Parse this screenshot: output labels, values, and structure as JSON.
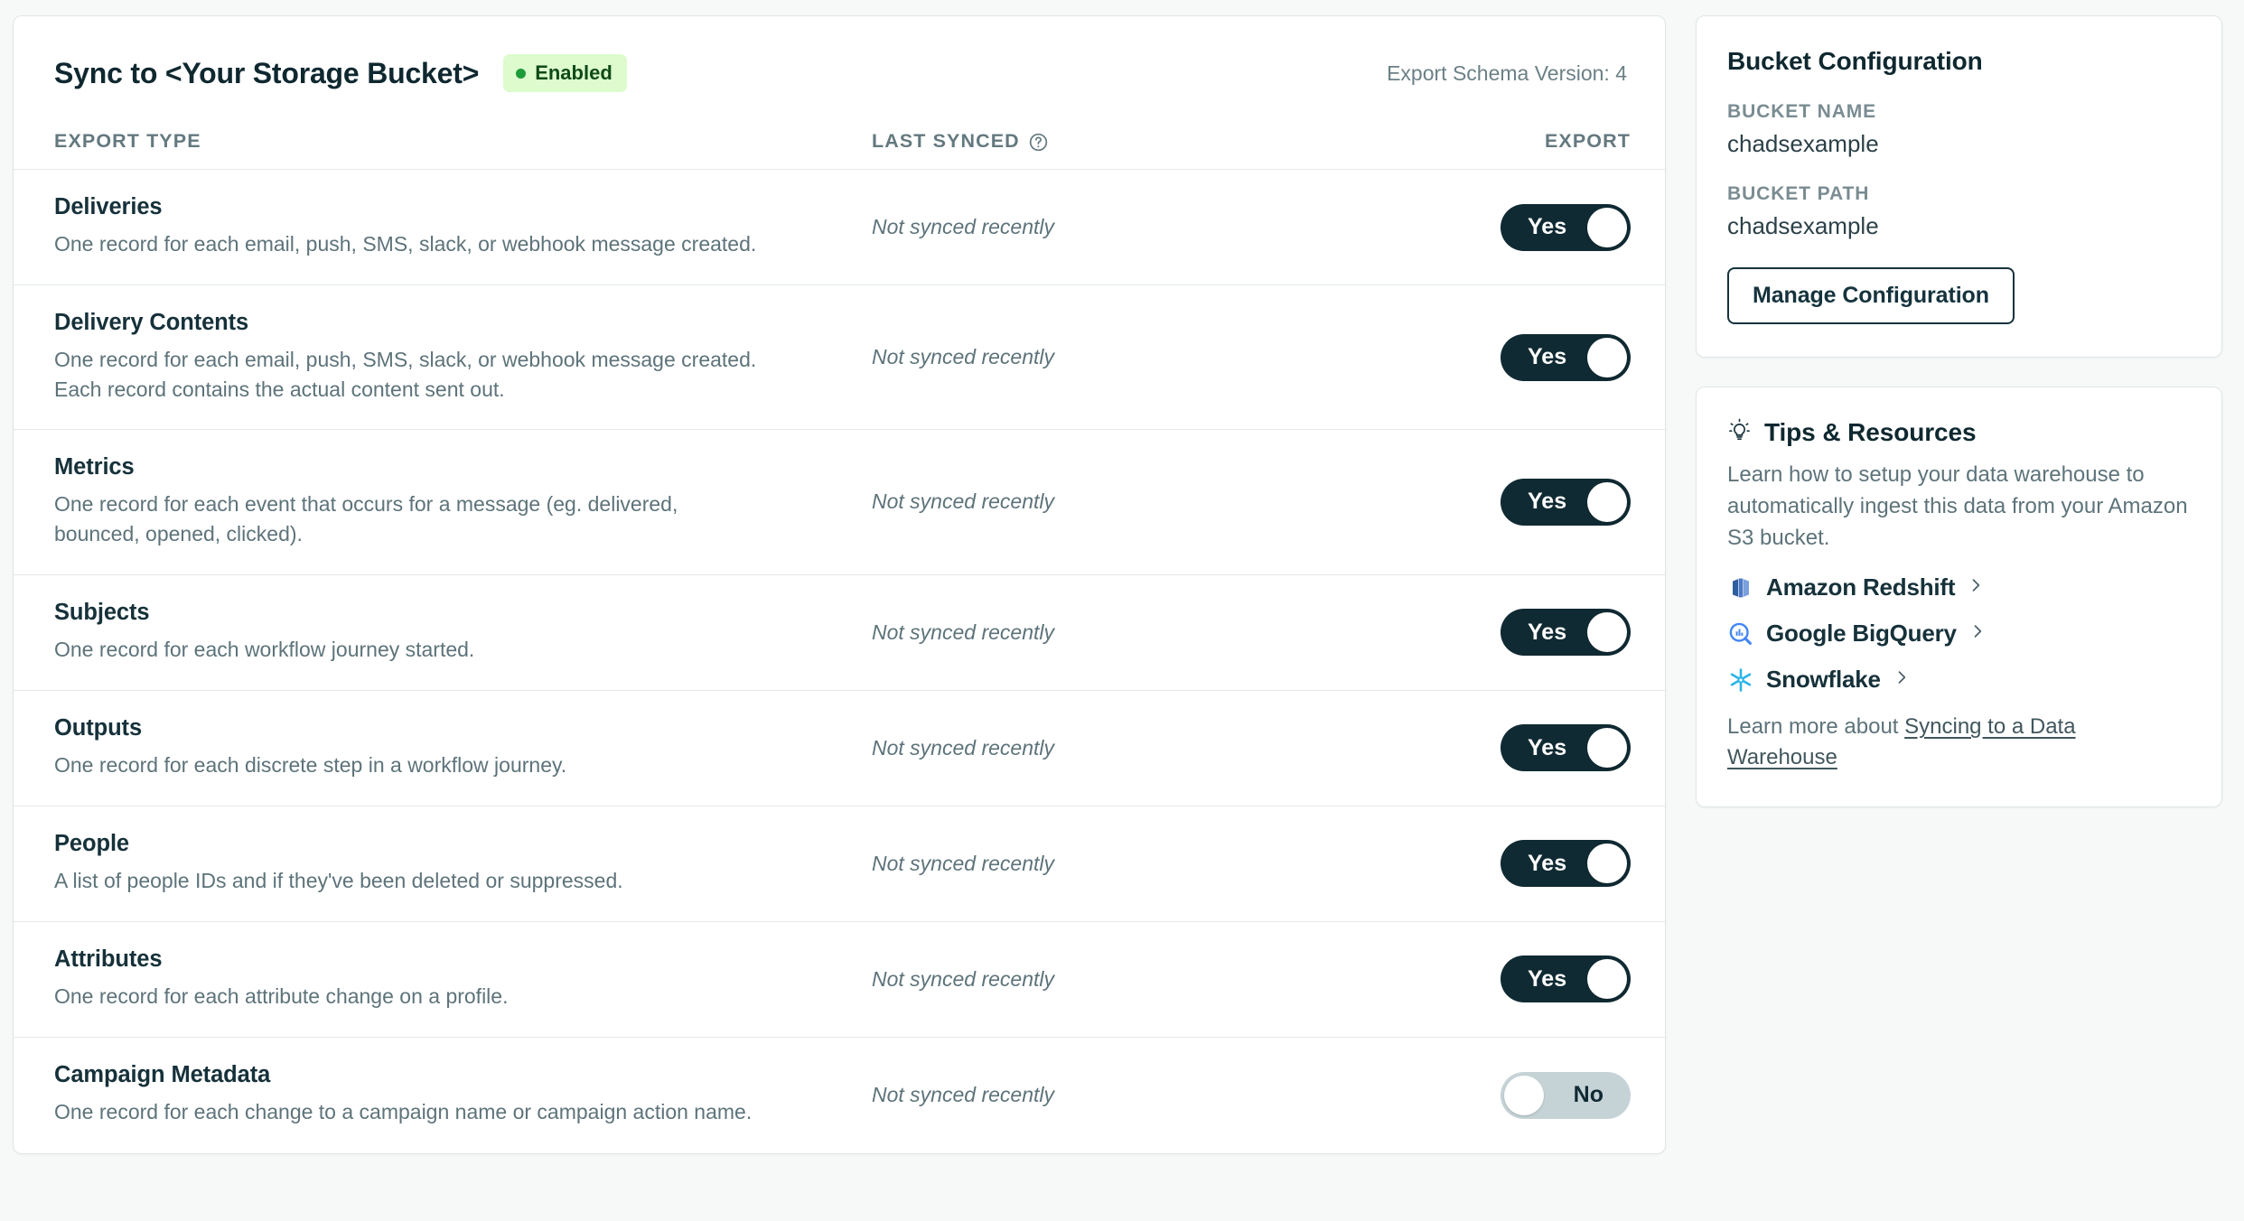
{
  "sync_card": {
    "title": "Sync to <Your Storage Bucket>",
    "status_badge": "Enabled",
    "status_color": "#1f9c3a",
    "schema_version": "Export Schema Version: 4",
    "columns": {
      "export_type": "EXPORT TYPE",
      "last_synced": "LAST SYNCED",
      "last_synced_help_icon": "help-circle-icon",
      "export": "EXPORT"
    },
    "rows": [
      {
        "name": "Deliveries",
        "description": "One record for each email, push, SMS, slack, or webhook message created.",
        "last_synced": "Not synced recently",
        "toggle_label": "Yes",
        "toggle_on": true
      },
      {
        "name": "Delivery Contents",
        "description": "One record for each email, push, SMS, slack, or webhook message created. Each record contains the actual content sent out.",
        "last_synced": "Not synced recently",
        "toggle_label": "Yes",
        "toggle_on": true
      },
      {
        "name": "Metrics",
        "description": "One record for each event that occurs for a message (eg. delivered, bounced, opened, clicked).",
        "last_synced": "Not synced recently",
        "toggle_label": "Yes",
        "toggle_on": true
      },
      {
        "name": "Subjects",
        "description": "One record for each workflow journey started.",
        "last_synced": "Not synced recently",
        "toggle_label": "Yes",
        "toggle_on": true
      },
      {
        "name": "Outputs",
        "description": "One record for each discrete step in a workflow journey.",
        "last_synced": "Not synced recently",
        "toggle_label": "Yes",
        "toggle_on": true
      },
      {
        "name": "People",
        "description": "A list of people IDs and if they've been deleted or suppressed.",
        "last_synced": "Not synced recently",
        "toggle_label": "Yes",
        "toggle_on": true
      },
      {
        "name": "Attributes",
        "description": "One record for each attribute change on a profile.",
        "last_synced": "Not synced recently",
        "toggle_label": "Yes",
        "toggle_on": true
      },
      {
        "name": "Campaign Metadata",
        "description": "One record for each change to a campaign name or campaign action name.",
        "last_synced": "Not synced recently",
        "toggle_label": "No",
        "toggle_on": false
      }
    ]
  },
  "bucket_config": {
    "title": "Bucket Configuration",
    "bucket_name_label": "BUCKET NAME",
    "bucket_name_value": "chadsexample",
    "bucket_path_label": "BUCKET PATH",
    "bucket_path_value": "chadsexample",
    "manage_button": "Manage Configuration"
  },
  "tips": {
    "icon": "lightbulb-icon",
    "title": "Tips & Resources",
    "description": "Learn how to setup your data warehouse to automatically ingest this data from your Amazon S3 bucket.",
    "resources": [
      {
        "label": "Amazon Redshift",
        "icon": "amazon-redshift-icon",
        "color": "#4d79c7"
      },
      {
        "label": "Google BigQuery",
        "icon": "google-bigquery-icon",
        "color": "#4386f4"
      },
      {
        "label": "Snowflake",
        "icon": "snowflake-icon",
        "color": "#29b5e8"
      }
    ],
    "learn_more_prefix": "Learn more about ",
    "learn_more_link": "Syncing to a Data Warehouse"
  }
}
